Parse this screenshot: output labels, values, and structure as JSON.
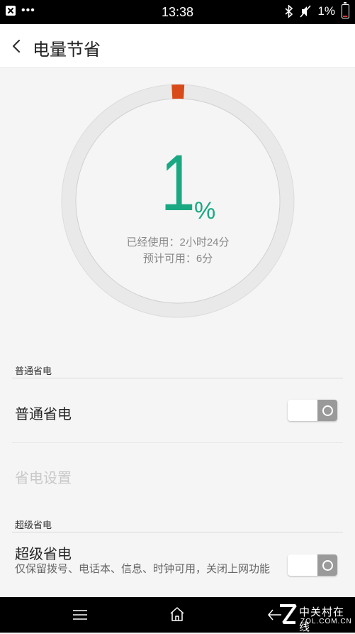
{
  "status_bar": {
    "time": "13:38",
    "battery_percent": "1%",
    "icons": [
      "notification-icon",
      "more-dots-icon",
      "bluetooth-icon",
      "silent-icon",
      "battery-icon"
    ]
  },
  "header": {
    "title": "电量节省"
  },
  "battery": {
    "level": "1",
    "level_fraction": 0.01,
    "percent_sign": "%",
    "used_label": "已经使用：2小时24分",
    "remaining_label": "预计可用：6分",
    "accent_color": "#1aa882",
    "ring_marker_color": "#d94a1a"
  },
  "normal_saving": {
    "section_title": "普通省电",
    "toggle_label": "普通省电",
    "toggle_on": false,
    "settings_label": "省电设置"
  },
  "super_saving": {
    "section_title": "超级省电",
    "toggle_label": "超级省电",
    "description": "仅保留拨号、电话本、信息、时钟可用，关闭上网功能",
    "toggle_on": false
  },
  "watermark": {
    "name": "中关村在线",
    "domain": "ZOL.COM.CN"
  }
}
